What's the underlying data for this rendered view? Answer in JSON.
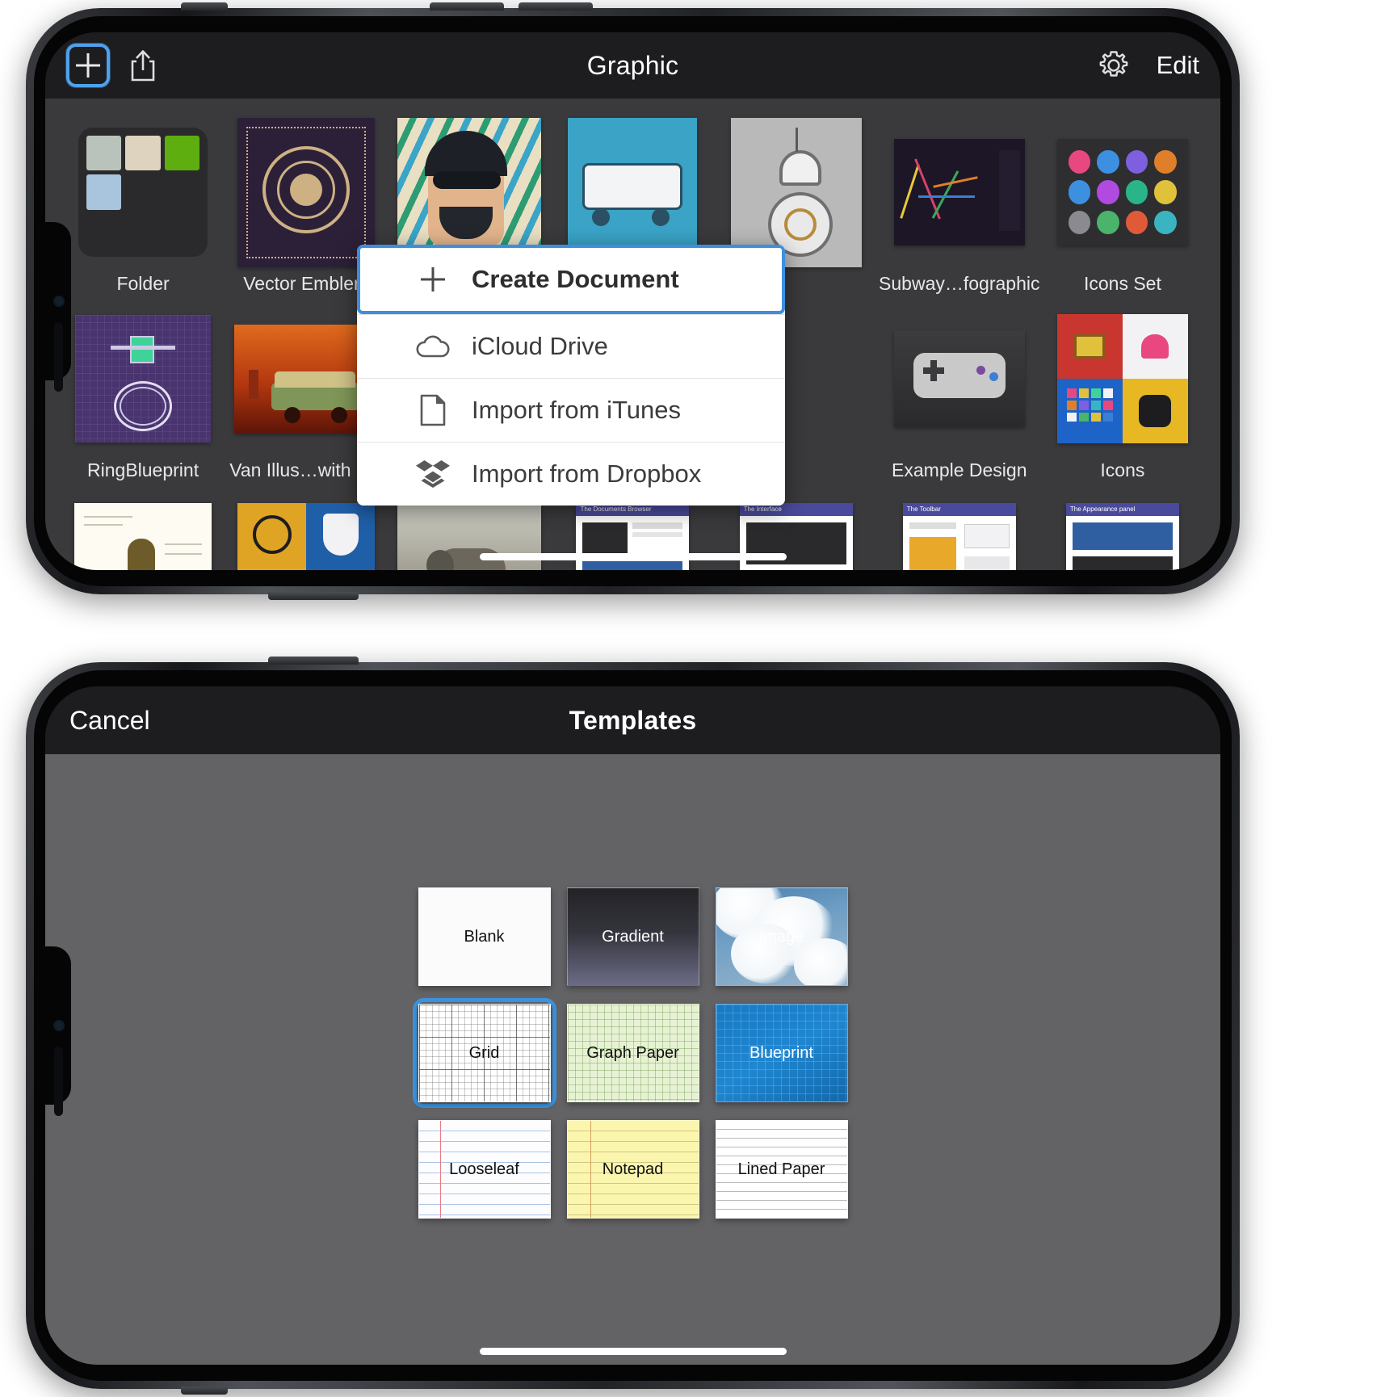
{
  "top_phone": {
    "nav": {
      "add_icon": "plus-icon",
      "share_icon": "share-icon",
      "title": "Graphic",
      "settings_icon": "gear-icon",
      "edit_label": "Edit"
    },
    "documents": [
      {
        "label": "Folder",
        "kind": "folder"
      },
      {
        "label": "Vector Emblem",
        "kind": "emblem"
      },
      {
        "label": "",
        "kind": "portrait"
      },
      {
        "label": "",
        "kind": "truck"
      },
      {
        "label": "",
        "kind": "droid"
      },
      {
        "label": "Subway…fographic",
        "kind": "subway"
      },
      {
        "label": "Icons Set",
        "kind": "iconset"
      },
      {
        "label": "RingBlueprint",
        "kind": "ring"
      },
      {
        "label": "Van Illus…with BG",
        "kind": "van"
      },
      {
        "label": "",
        "kind": "hidden"
      },
      {
        "label": "",
        "kind": "hidden"
      },
      {
        "label": "",
        "kind": "hidden"
      },
      {
        "label": "Example Design",
        "kind": "gamepad"
      },
      {
        "label": "Icons",
        "kind": "icons4"
      },
      {
        "label": "",
        "kind": "poster-bug"
      },
      {
        "label": "",
        "kind": "badges"
      },
      {
        "label": "",
        "kind": "elephant"
      },
      {
        "label": "The Documents Browser",
        "kind": "manual"
      },
      {
        "label": "The Interface",
        "kind": "manual"
      },
      {
        "label": "The Toolbar",
        "kind": "manual"
      },
      {
        "label": "The Appearance panel",
        "kind": "manual"
      }
    ],
    "popup": {
      "items": [
        {
          "label": "Create Document",
          "icon": "plus-icon",
          "selected": true
        },
        {
          "label": "iCloud Drive",
          "icon": "cloud-icon",
          "selected": false
        },
        {
          "label": "Import from iTunes",
          "icon": "document-icon",
          "selected": false
        },
        {
          "label": "Import from Dropbox",
          "icon": "dropbox-icon",
          "selected": false
        }
      ]
    }
  },
  "bottom_phone": {
    "nav": {
      "cancel_label": "Cancel",
      "title": "Templates"
    },
    "templates": [
      {
        "label": "Blank",
        "style": "bg-blank",
        "selected": false
      },
      {
        "label": "Gradient",
        "style": "bg-gradient",
        "selected": false
      },
      {
        "label": "Image",
        "style": "bg-image",
        "selected": false
      },
      {
        "label": "Grid",
        "style": "bg-grid",
        "selected": true
      },
      {
        "label": "Graph Paper",
        "style": "bg-graph",
        "selected": false
      },
      {
        "label": "Blueprint",
        "style": "bg-blue",
        "selected": false
      },
      {
        "label": "Looseleaf",
        "style": "bg-loose",
        "selected": false
      },
      {
        "label": "Notepad",
        "style": "bg-notepad",
        "selected": false
      },
      {
        "label": "Lined Paper",
        "style": "bg-lined",
        "selected": false
      }
    ]
  },
  "colors": {
    "accent_blue": "#3b94e0",
    "nav_bar": "#1d1d1f",
    "browser_bg": "#3a3a3c",
    "templates_bg": "#636366",
    "popup_bg": "#ffffff"
  }
}
